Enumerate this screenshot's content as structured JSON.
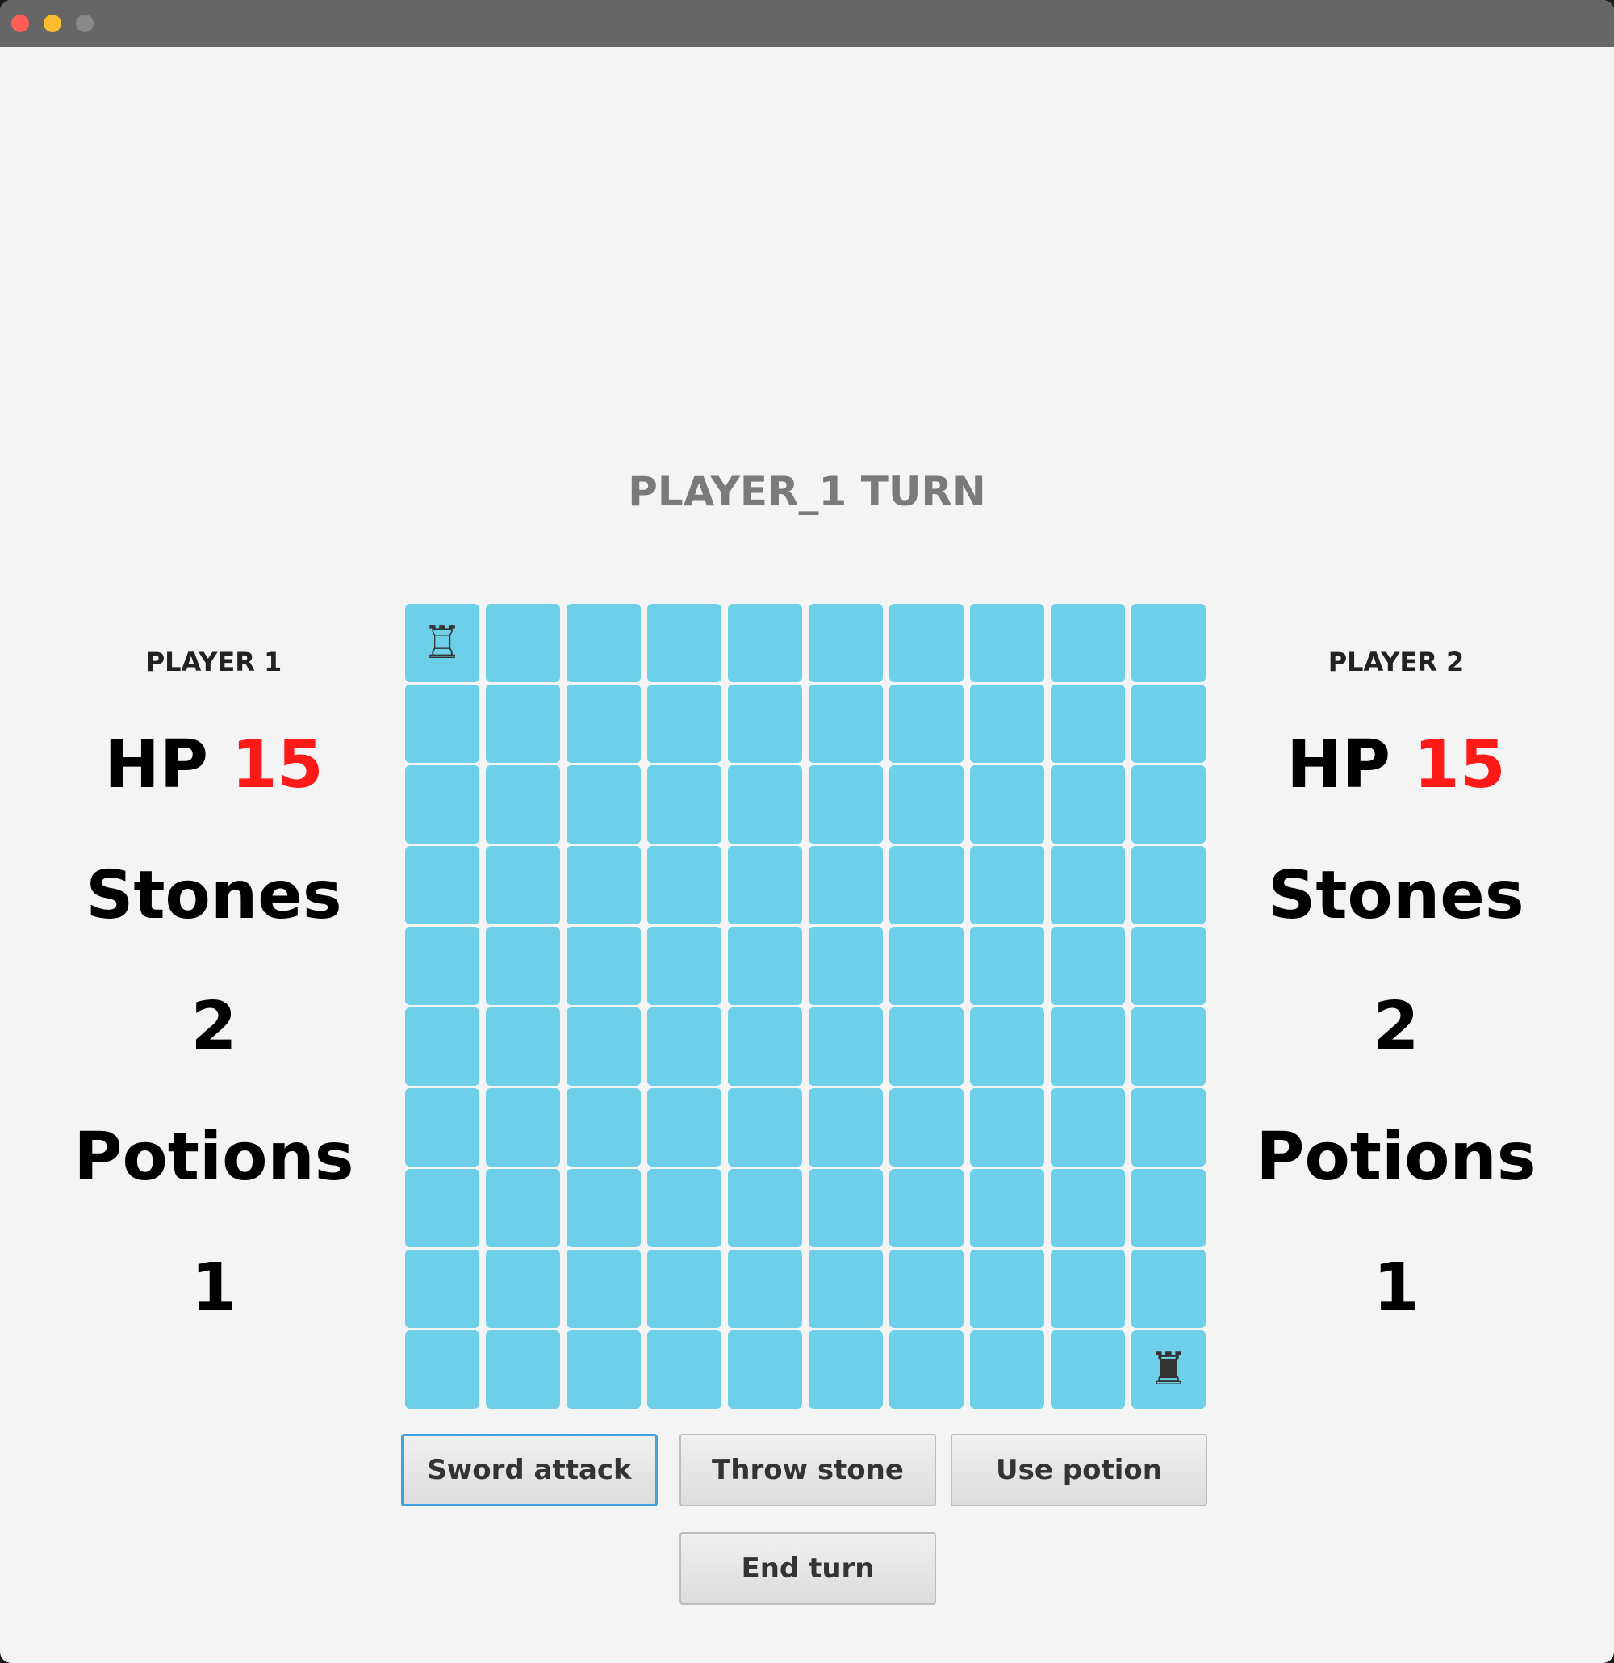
{
  "window": {
    "traffic_lights": {
      "close_color": "#ff5f57",
      "minimize_color": "#febc2e",
      "maximize_color": "#8a8a8a"
    }
  },
  "game": {
    "turn_label": "PLAYER_1 TURN",
    "board": {
      "rows": 10,
      "cols": 10,
      "cell_color": "#6dd0e8",
      "pieces": [
        {
          "row": 0,
          "col": 0,
          "icon": "white-rook-icon",
          "glyph": "♖"
        },
        {
          "row": 9,
          "col": 9,
          "icon": "black-rook-icon",
          "glyph": "♜"
        }
      ]
    }
  },
  "player1": {
    "name": "PLAYER 1",
    "hp_label": "HP",
    "hp_value": "15",
    "stones_label": "Stones",
    "stones_value": "2",
    "potions_label": "Potions",
    "potions_value": "1"
  },
  "player2": {
    "name": "PLAYER 2",
    "hp_label": "HP",
    "hp_value": "15",
    "stones_label": "Stones",
    "stones_value": "2",
    "potions_label": "Potions",
    "potions_value": "1"
  },
  "actions": {
    "sword_attack": "Sword attack",
    "throw_stone": "Throw stone",
    "use_potion": "Use potion",
    "end_turn": "End turn"
  },
  "colors": {
    "hp_value": "#ff1a1a",
    "focus_border": "#3fa1de"
  }
}
